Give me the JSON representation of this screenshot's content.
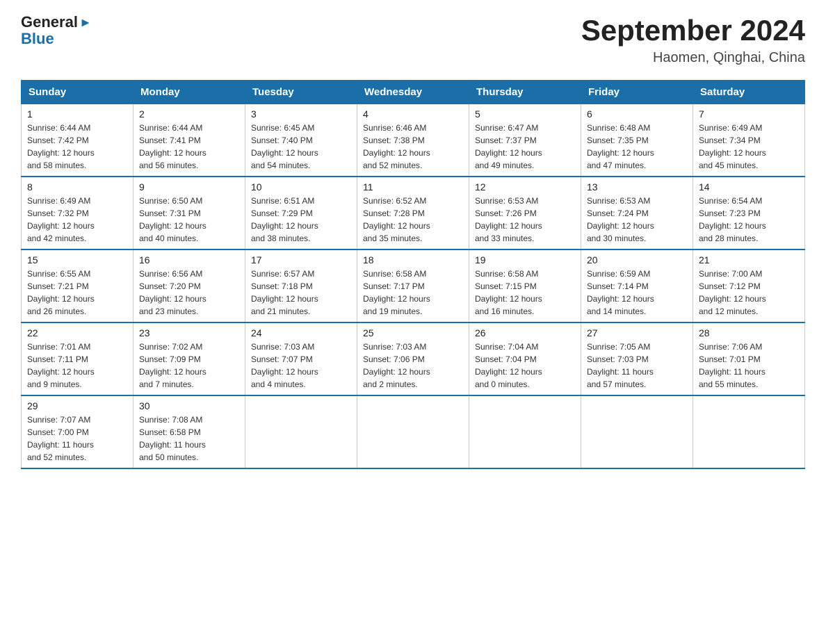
{
  "logo": {
    "general": "General",
    "arrow": "▶",
    "blue": "Blue"
  },
  "title": {
    "month_year": "September 2024",
    "location": "Haomen, Qinghai, China"
  },
  "headers": [
    "Sunday",
    "Monday",
    "Tuesday",
    "Wednesday",
    "Thursday",
    "Friday",
    "Saturday"
  ],
  "weeks": [
    [
      {
        "day": "1",
        "info": "Sunrise: 6:44 AM\nSunset: 7:42 PM\nDaylight: 12 hours\nand 58 minutes."
      },
      {
        "day": "2",
        "info": "Sunrise: 6:44 AM\nSunset: 7:41 PM\nDaylight: 12 hours\nand 56 minutes."
      },
      {
        "day": "3",
        "info": "Sunrise: 6:45 AM\nSunset: 7:40 PM\nDaylight: 12 hours\nand 54 minutes."
      },
      {
        "day": "4",
        "info": "Sunrise: 6:46 AM\nSunset: 7:38 PM\nDaylight: 12 hours\nand 52 minutes."
      },
      {
        "day": "5",
        "info": "Sunrise: 6:47 AM\nSunset: 7:37 PM\nDaylight: 12 hours\nand 49 minutes."
      },
      {
        "day": "6",
        "info": "Sunrise: 6:48 AM\nSunset: 7:35 PM\nDaylight: 12 hours\nand 47 minutes."
      },
      {
        "day": "7",
        "info": "Sunrise: 6:49 AM\nSunset: 7:34 PM\nDaylight: 12 hours\nand 45 minutes."
      }
    ],
    [
      {
        "day": "8",
        "info": "Sunrise: 6:49 AM\nSunset: 7:32 PM\nDaylight: 12 hours\nand 42 minutes."
      },
      {
        "day": "9",
        "info": "Sunrise: 6:50 AM\nSunset: 7:31 PM\nDaylight: 12 hours\nand 40 minutes."
      },
      {
        "day": "10",
        "info": "Sunrise: 6:51 AM\nSunset: 7:29 PM\nDaylight: 12 hours\nand 38 minutes."
      },
      {
        "day": "11",
        "info": "Sunrise: 6:52 AM\nSunset: 7:28 PM\nDaylight: 12 hours\nand 35 minutes."
      },
      {
        "day": "12",
        "info": "Sunrise: 6:53 AM\nSunset: 7:26 PM\nDaylight: 12 hours\nand 33 minutes."
      },
      {
        "day": "13",
        "info": "Sunrise: 6:53 AM\nSunset: 7:24 PM\nDaylight: 12 hours\nand 30 minutes."
      },
      {
        "day": "14",
        "info": "Sunrise: 6:54 AM\nSunset: 7:23 PM\nDaylight: 12 hours\nand 28 minutes."
      }
    ],
    [
      {
        "day": "15",
        "info": "Sunrise: 6:55 AM\nSunset: 7:21 PM\nDaylight: 12 hours\nand 26 minutes."
      },
      {
        "day": "16",
        "info": "Sunrise: 6:56 AM\nSunset: 7:20 PM\nDaylight: 12 hours\nand 23 minutes."
      },
      {
        "day": "17",
        "info": "Sunrise: 6:57 AM\nSunset: 7:18 PM\nDaylight: 12 hours\nand 21 minutes."
      },
      {
        "day": "18",
        "info": "Sunrise: 6:58 AM\nSunset: 7:17 PM\nDaylight: 12 hours\nand 19 minutes."
      },
      {
        "day": "19",
        "info": "Sunrise: 6:58 AM\nSunset: 7:15 PM\nDaylight: 12 hours\nand 16 minutes."
      },
      {
        "day": "20",
        "info": "Sunrise: 6:59 AM\nSunset: 7:14 PM\nDaylight: 12 hours\nand 14 minutes."
      },
      {
        "day": "21",
        "info": "Sunrise: 7:00 AM\nSunset: 7:12 PM\nDaylight: 12 hours\nand 12 minutes."
      }
    ],
    [
      {
        "day": "22",
        "info": "Sunrise: 7:01 AM\nSunset: 7:11 PM\nDaylight: 12 hours\nand 9 minutes."
      },
      {
        "day": "23",
        "info": "Sunrise: 7:02 AM\nSunset: 7:09 PM\nDaylight: 12 hours\nand 7 minutes."
      },
      {
        "day": "24",
        "info": "Sunrise: 7:03 AM\nSunset: 7:07 PM\nDaylight: 12 hours\nand 4 minutes."
      },
      {
        "day": "25",
        "info": "Sunrise: 7:03 AM\nSunset: 7:06 PM\nDaylight: 12 hours\nand 2 minutes."
      },
      {
        "day": "26",
        "info": "Sunrise: 7:04 AM\nSunset: 7:04 PM\nDaylight: 12 hours\nand 0 minutes."
      },
      {
        "day": "27",
        "info": "Sunrise: 7:05 AM\nSunset: 7:03 PM\nDaylight: 11 hours\nand 57 minutes."
      },
      {
        "day": "28",
        "info": "Sunrise: 7:06 AM\nSunset: 7:01 PM\nDaylight: 11 hours\nand 55 minutes."
      }
    ],
    [
      {
        "day": "29",
        "info": "Sunrise: 7:07 AM\nSunset: 7:00 PM\nDaylight: 11 hours\nand 52 minutes."
      },
      {
        "day": "30",
        "info": "Sunrise: 7:08 AM\nSunset: 6:58 PM\nDaylight: 11 hours\nand 50 minutes."
      },
      {
        "day": "",
        "info": ""
      },
      {
        "day": "",
        "info": ""
      },
      {
        "day": "",
        "info": ""
      },
      {
        "day": "",
        "info": ""
      },
      {
        "day": "",
        "info": ""
      }
    ]
  ]
}
